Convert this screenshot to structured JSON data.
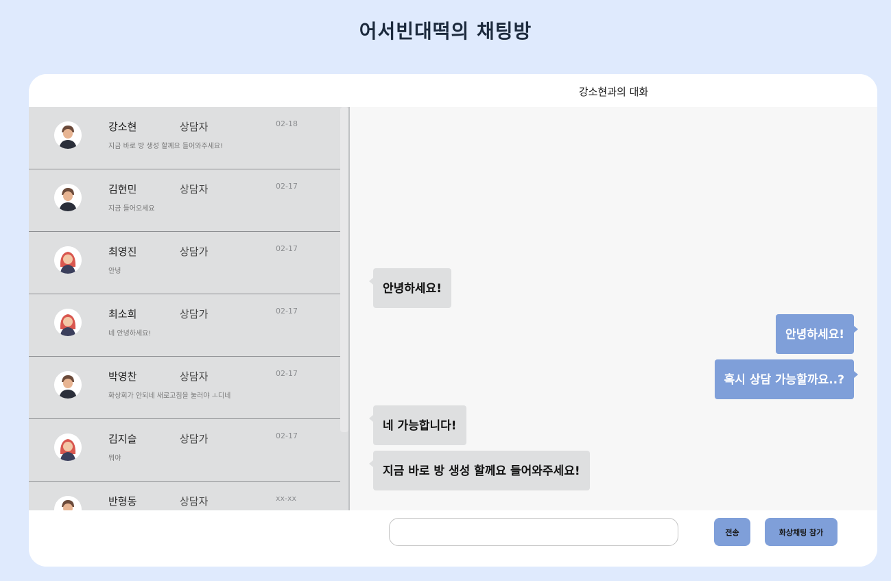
{
  "page": {
    "title": "어서빈대떡의 채팅방"
  },
  "chat_list": [
    {
      "name": "강소현",
      "role": "상담자",
      "date": "02-18",
      "preview": "지금 바로 방 생성 할께요 들어와주세요!",
      "avatar": "male-avatar"
    },
    {
      "name": "김현민",
      "role": "상담자",
      "date": "02-17",
      "preview": "지금 들어오세요",
      "avatar": "male-avatar"
    },
    {
      "name": "최영진",
      "role": "상담가",
      "date": "02-17",
      "preview": "안녕",
      "avatar": "female-avatar"
    },
    {
      "name": "최소희",
      "role": "상담가",
      "date": "02-17",
      "preview": "네 안녕하세요!",
      "avatar": "female-avatar"
    },
    {
      "name": "박영찬",
      "role": "상담자",
      "date": "02-17",
      "preview": "화상회가 안되네 새로고침을 눌러야 ㅗ디네",
      "avatar": "male-avatar"
    },
    {
      "name": "김지슬",
      "role": "상담가",
      "date": "02-17",
      "preview": "뭐야",
      "avatar": "female-avatar"
    },
    {
      "name": "반형동",
      "role": "상담자",
      "date": "xx-xx",
      "preview": "",
      "avatar": "male-avatar"
    }
  ],
  "chat": {
    "header": "강소현과의 대화",
    "messages": [
      {
        "side": "in",
        "text": "안녕하세요!"
      },
      {
        "side": "out",
        "text": "안녕하세요!"
      },
      {
        "side": "out",
        "text": "혹시 상담 가능할까요..?"
      },
      {
        "side": "in",
        "text": "네 가능합니다!"
      },
      {
        "side": "in",
        "text": "지금 바로 방 생성 할께요 들어와주세요!"
      }
    ]
  },
  "composer": {
    "input_value": "",
    "input_placeholder": "",
    "send_label": "전송",
    "video_label": "화상채팅 참가"
  },
  "colors": {
    "background": "#dfeafd",
    "accent": "#7f9fd9",
    "list_bg": "#dedfe0",
    "chat_bg": "#f7f7f7"
  }
}
